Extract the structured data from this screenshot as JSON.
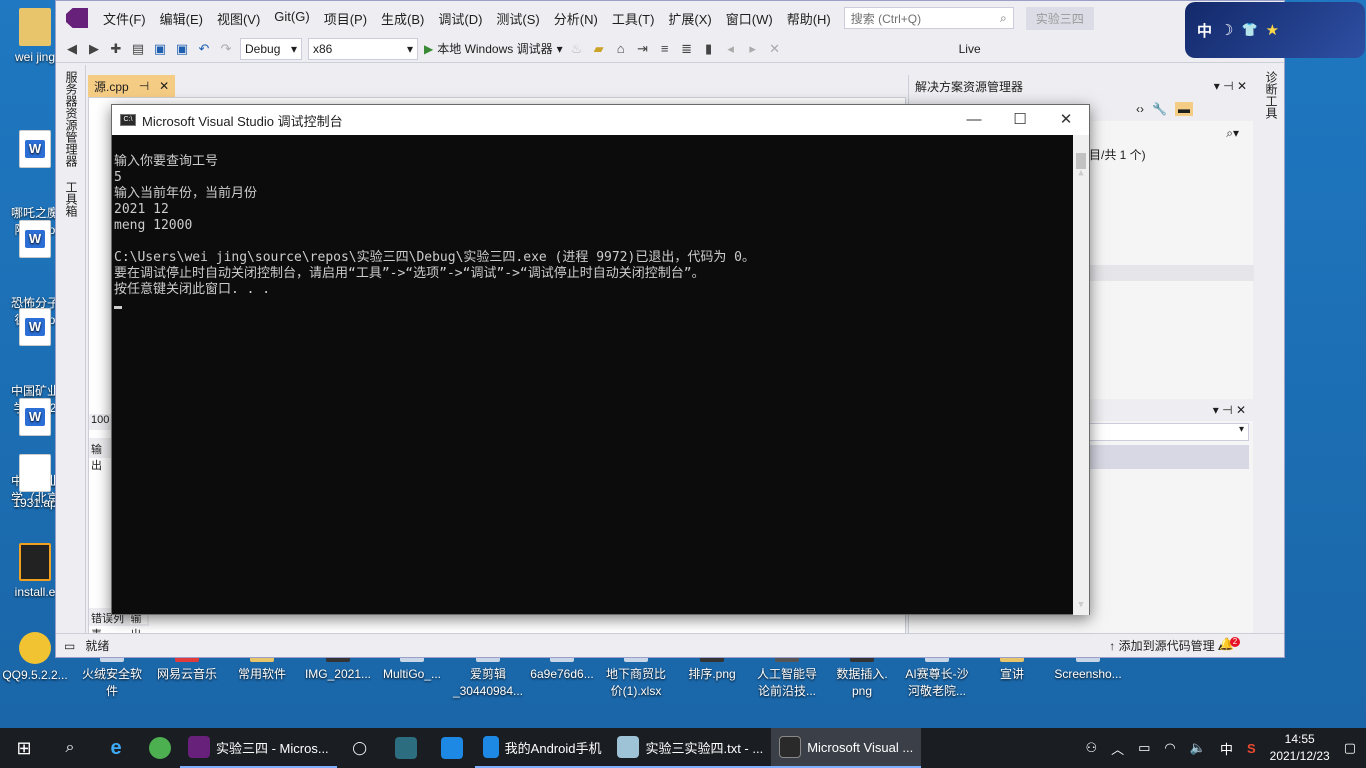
{
  "desktop": {
    "left_icons": [
      {
        "label": "wei jing",
        "icon": "user-folder-icon"
      },
      {
        "label": "哪吒之魔\n降世.do",
        "icon": "word-doc-icon"
      },
      {
        "label": "恐怖分子\n德昌.do",
        "icon": "word-doc-icon"
      },
      {
        "label": "中国矿业\n学北京2",
        "icon": "word-doc-icon"
      },
      {
        "label": "中国矿业\n学（北京",
        "icon": "word-doc-icon"
      },
      {
        "label": "1931.ap",
        "icon": "file-icon"
      },
      {
        "label": "install.e",
        "icon": "installer-icon"
      },
      {
        "label": "QQ9.5.2.2...",
        "icon": "qq-icon"
      }
    ],
    "bottom_icons": [
      {
        "label": "火绒安全软\n件"
      },
      {
        "label": "网易云音乐"
      },
      {
        "label": "常用软件"
      },
      {
        "label": "IMG_2021..."
      },
      {
        "label": "MultiGo_..."
      },
      {
        "label": "爱剪辑\n_30440984..."
      },
      {
        "label": "6a9e76d6..."
      },
      {
        "label": "地下商贸比\n价(1).xlsx"
      },
      {
        "label": "排序.png"
      },
      {
        "label": "人工智能导\n论前沿技..."
      },
      {
        "label": "数据插入.\npng"
      },
      {
        "label": "AI赛尊长-沙\n河敬老院..."
      },
      {
        "label": "宣讲"
      },
      {
        "label": "Screensho..."
      }
    ]
  },
  "ime": {
    "label": "中",
    "moon": "☽",
    "shirt": "👕",
    "star": "★"
  },
  "vs": {
    "menu": [
      "文件(F)",
      "编辑(E)",
      "视图(V)",
      "Git(G)",
      "项目(P)",
      "生成(B)",
      "调试(D)",
      "测试(S)",
      "分析(N)",
      "工具(T)",
      "扩展(X)",
      "窗口(W)",
      "帮助(H)"
    ],
    "search_placeholder": "搜索 (Ctrl+Q)",
    "solution_name": "实验三四",
    "toolbar": {
      "config": "Debug",
      "platform": "x86",
      "run_label": "本地 Windows 调试器",
      "live_share": "Live"
    },
    "left_tabs": [
      "服务器资源管理器",
      "工具箱"
    ],
    "right_tab": "诊断工具",
    "doc_tab": "源.cpp",
    "solution_explorer_title": "解决方案资源管理器",
    "solution_info": "目/共 1 个)",
    "status_ready": "就绪",
    "status_source": "↑ 添加到源代码管理 ▴",
    "notif_count": "2",
    "zoom": "100",
    "output_tab": "输出",
    "error_list_tab": "错误列表",
    "output_tab2": "输出"
  },
  "console": {
    "title": "Microsoft Visual Studio 调试控制台",
    "lines": [
      "输入你要查询工号",
      "5",
      "输入当前年份，当前月份",
      "2021 12",
      "meng 12000",
      "",
      "C:\\Users\\wei jing\\source\\repos\\实验三四\\Debug\\实验三四.exe (进程 9972)已退出，代码为 0。",
      "要在调试停止时自动关闭控制台，请启用“工具”->“选项”->“调试”->“调试停止时自动关闭控制台”。",
      "按任意键关闭此窗口. . ."
    ]
  },
  "taskbar": {
    "items": [
      {
        "label": "实验三四 - Micros...",
        "icon": "visual-studio-icon"
      },
      {
        "label": "我的Android手机",
        "icon": "phone-icon"
      },
      {
        "label": "实验三实验四.txt - ...",
        "icon": "notepad-icon"
      },
      {
        "label": "Microsoft Visual ...",
        "icon": "console-icon"
      }
    ],
    "ime": "中",
    "time": "14:55",
    "date": "2021/12/23"
  }
}
